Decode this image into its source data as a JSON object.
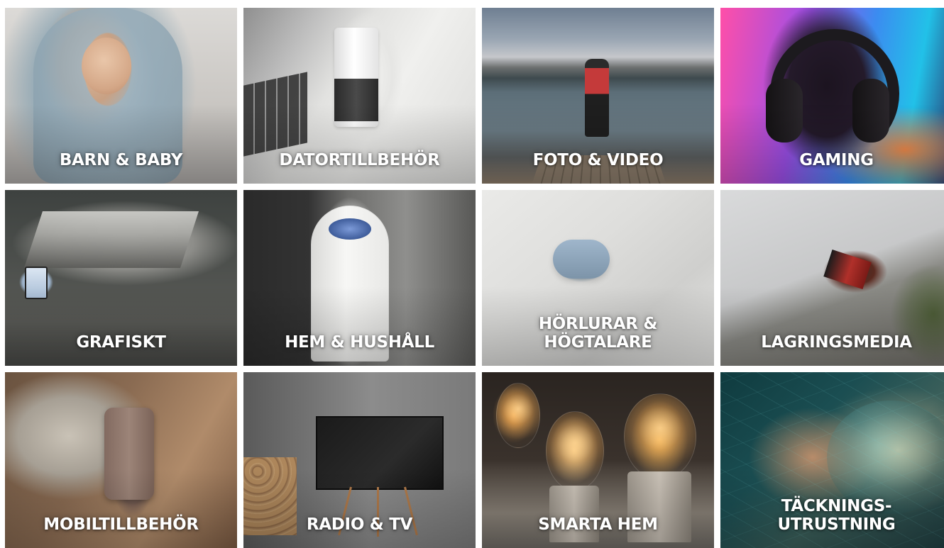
{
  "categories": [
    {
      "label": "BARN & BABY"
    },
    {
      "label": "DATORTILLBEHÖR"
    },
    {
      "label": "FOTO & VIDEO"
    },
    {
      "label": "GAMING"
    },
    {
      "label": "GRAFISKT"
    },
    {
      "label": "HEM & HUSHÅLL"
    },
    {
      "label": "HÖRLURAR &\nHÖGTALARE"
    },
    {
      "label": "LAGRINGSMEDIA"
    },
    {
      "label": "MOBILTILLBEHÖR"
    },
    {
      "label": "RADIO & TV"
    },
    {
      "label": "SMARTA HEM"
    },
    {
      "label": "TÄCKNINGS-\nUTRUSTNING"
    }
  ]
}
